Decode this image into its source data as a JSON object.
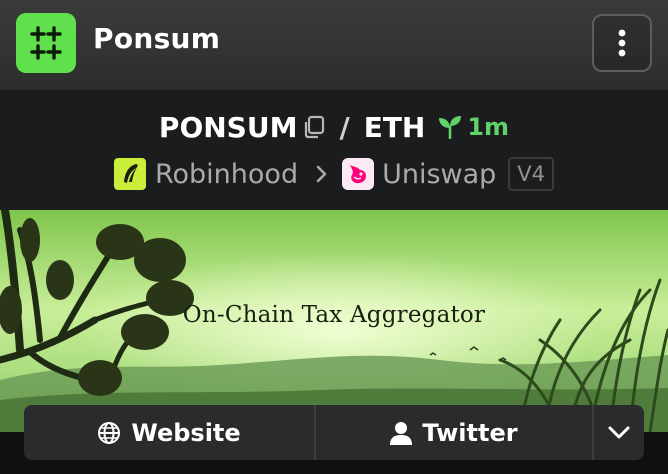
{
  "app": {
    "title": "Ponsum",
    "logo_icon": "grid-plus-icon",
    "logo_color": "#5fe04c"
  },
  "pair": {
    "base": "PONSUM",
    "separator": "/",
    "quote": "ETH",
    "age": "1m",
    "age_color": "#5fd36a"
  },
  "dex": {
    "chain": "Robinhood",
    "dex_name": "Uniswap",
    "version": "V4"
  },
  "banner": {
    "title": "On-Chain Tax Aggregator"
  },
  "links": {
    "website_label": "Website",
    "twitter_label": "Twitter"
  },
  "icons": {
    "copy": "copy-icon",
    "seedling": "seedling-icon",
    "menu": "more-vertical-icon",
    "globe": "globe-icon",
    "user": "user-icon",
    "chevron": "chevron-down-icon"
  }
}
